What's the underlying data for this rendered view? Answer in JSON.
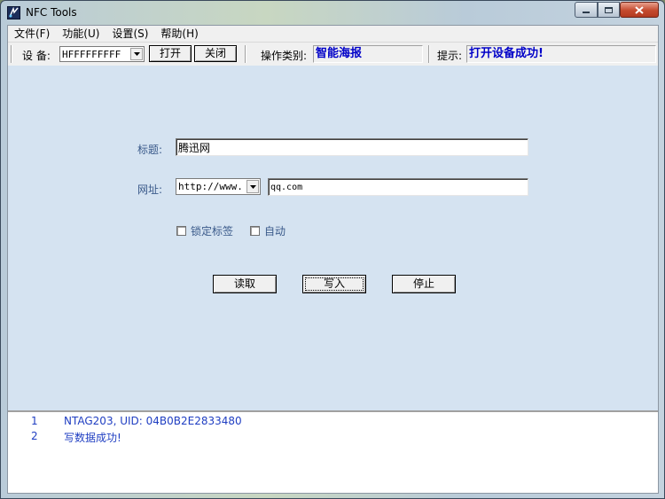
{
  "window": {
    "title": "NFC Tools"
  },
  "menu": [
    {
      "label": "文件(F)"
    },
    {
      "label": "功能(U)"
    },
    {
      "label": "设置(S)"
    },
    {
      "label": "帮助(H)"
    }
  ],
  "toolbar": {
    "device_label": "设 备:",
    "device_value": "HFFFFFFFFF",
    "open_label": "打开",
    "close_label": "关闭",
    "op_type_label": "操作类别:",
    "op_type_value": "智能海报",
    "hint_label": "提示:",
    "hint_value": "打开设备成功!"
  },
  "form": {
    "title_label": "标题:",
    "title_value": "腾迅网",
    "url_label": "网址:",
    "url_prefix": "http://www.",
    "url_value": "qq.com",
    "lock_label": "锁定标签",
    "auto_label": "自动",
    "read_label": "读取",
    "write_label": "写入",
    "stop_label": "停止"
  },
  "log": [
    {
      "num": "1",
      "text": "NTAG203, UID: 04B0B2E2833480"
    },
    {
      "num": "2",
      "text": "写数据成功!"
    }
  ],
  "colors": {
    "panel_bg": "#d5e3f1",
    "label_blue": "#3a5a8a",
    "status_blue": "#0000c8",
    "log_blue": "#1f3ec2"
  },
  "icons": [
    "app-icon",
    "minimize-icon",
    "maximize-icon",
    "close-icon",
    "dropdown-arrow-icon"
  ]
}
